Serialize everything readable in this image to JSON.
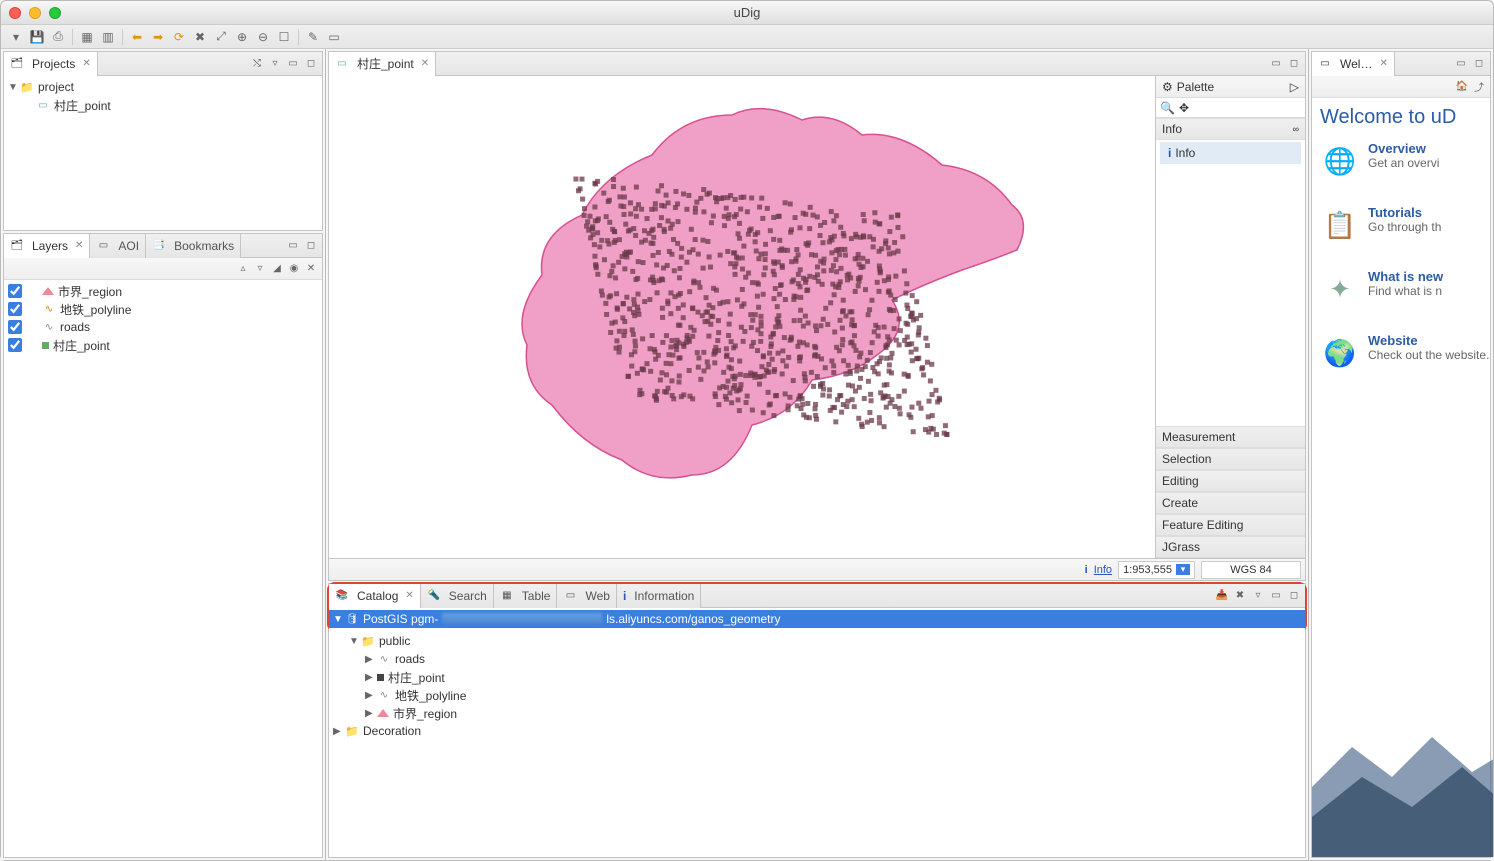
{
  "app_title": "uDig",
  "projects_tab": "Projects",
  "project_root": "project",
  "project_map": "村庄_point",
  "layers_tabs": {
    "layers": "Layers",
    "aoi": "AOI",
    "bookmarks": "Bookmarks"
  },
  "layers": [
    {
      "name": "市界_region",
      "icon": "poly"
    },
    {
      "name": "地铁_polyline",
      "icon": "line"
    },
    {
      "name": "roads",
      "icon": "line2"
    },
    {
      "name": "村庄_point",
      "icon": "pt"
    }
  ],
  "map_tab": "村庄_point",
  "palette": {
    "title": "Palette",
    "section_info": "Info",
    "info_item": "Info",
    "groups": [
      "Measurement",
      "Selection",
      "Editing",
      "Create",
      "Feature Editing",
      "JGrass"
    ]
  },
  "status": {
    "info": "Info",
    "scale": "1:953,555",
    "crs": "WGS 84"
  },
  "bottom": {
    "tabs": {
      "catalog": "Catalog",
      "search": "Search",
      "table": "Table",
      "web": "Web",
      "information": "Information"
    },
    "postgis_prefix": "PostGIS pgm-",
    "postgis_suffix": "ls.aliyuncs.com/ganos_geometry",
    "schema": "public",
    "tables": [
      {
        "name": "roads",
        "icon": "line2"
      },
      {
        "name": "村庄_point",
        "icon": "pt2"
      },
      {
        "name": "地铁_polyline",
        "icon": "line2"
      },
      {
        "name": "市界_region",
        "icon": "poly"
      }
    ],
    "decoration": "Decoration"
  },
  "welcome": {
    "tab": "Wel…",
    "title": "Welcome to uD",
    "items": [
      {
        "title": "Overview",
        "desc": "Get an overvi"
      },
      {
        "title": "Tutorials",
        "desc": "Go through th"
      },
      {
        "title": "What is new",
        "desc": "Find what is n"
      },
      {
        "title": "Website",
        "desc": "Check out the website."
      }
    ]
  }
}
